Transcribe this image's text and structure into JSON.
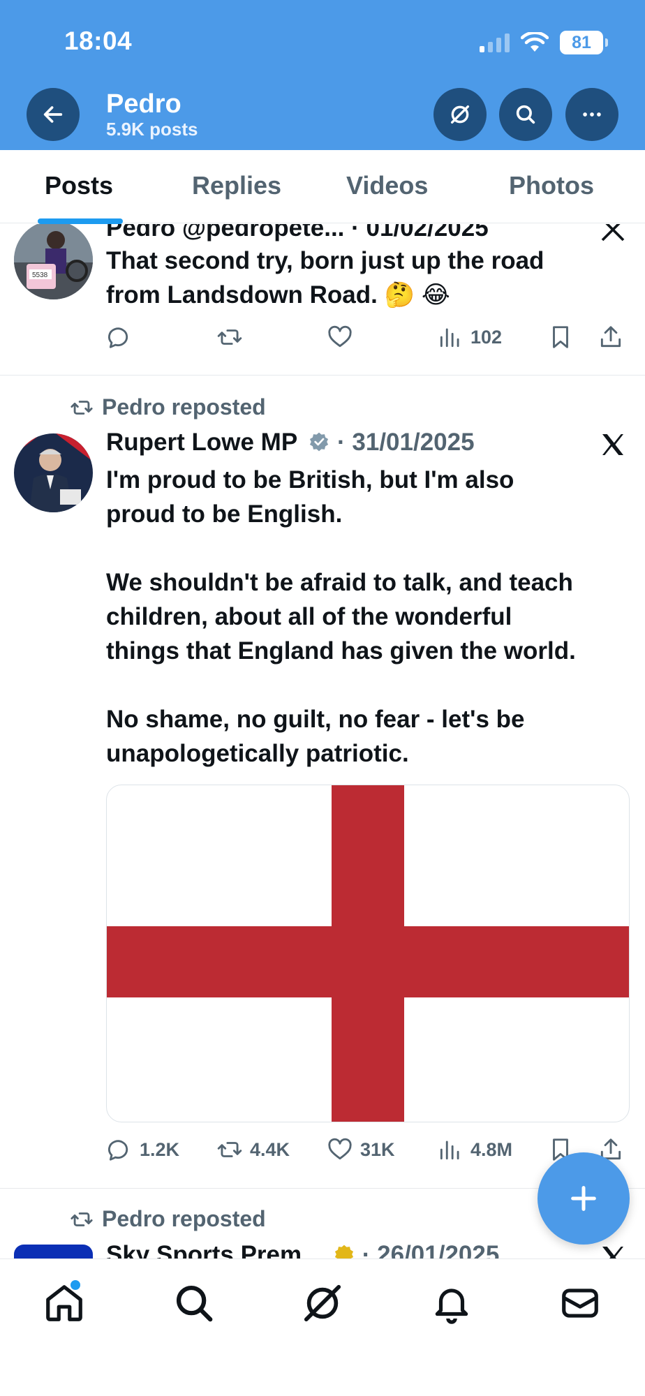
{
  "status_bar": {
    "time": "18:04",
    "battery": "81"
  },
  "header": {
    "name": "Pedro",
    "posts_count": "5.9K posts"
  },
  "tabs": [
    "Posts",
    "Replies",
    "Videos",
    "Photos"
  ],
  "tweets": [
    {
      "header_partial": "Pedro @pedropete... · 01/02/2025",
      "text_lines": [
        "That second try, born just up the road",
        "from Landsdown Road. 🤔 😂"
      ],
      "views": "102"
    },
    {
      "repost_label": "Pedro reposted",
      "author": "Rupert Lowe MP",
      "date": "· 31/01/2025",
      "text_lines": [
        "I'm proud to be British, but I'm also",
        "proud to be English.",
        "We shouldn't be afraid to talk, and teach",
        "children, about all of the wonderful",
        "things that England has given the world.",
        "No shame, no guilt, no fear - let's be",
        "unapologetically patriotic."
      ],
      "replies": "1.2K",
      "reposts": "4.4K",
      "likes": "31K",
      "views": "4.8M"
    },
    {
      "repost_label": "Pedro reposted",
      "author_partial": "Sky Sports Prem...",
      "date": "· 26/01/2025"
    }
  ],
  "colors": {
    "header_bg": "#4c9ae8",
    "header_button": "#1f4f7e",
    "accent": "#1d9bf0",
    "flag_red": "#bc2b33",
    "muted_text": "#536471"
  },
  "icons": [
    "back-arrow-icon",
    "grok-icon",
    "search-icon",
    "more-icon",
    "reply-icon",
    "repost-icon",
    "like-icon",
    "views-icon",
    "bookmark-icon",
    "share-icon",
    "x-logo-icon",
    "verified-badge-icon",
    "plus-icon",
    "home-icon",
    "bell-icon",
    "mail-icon"
  ]
}
